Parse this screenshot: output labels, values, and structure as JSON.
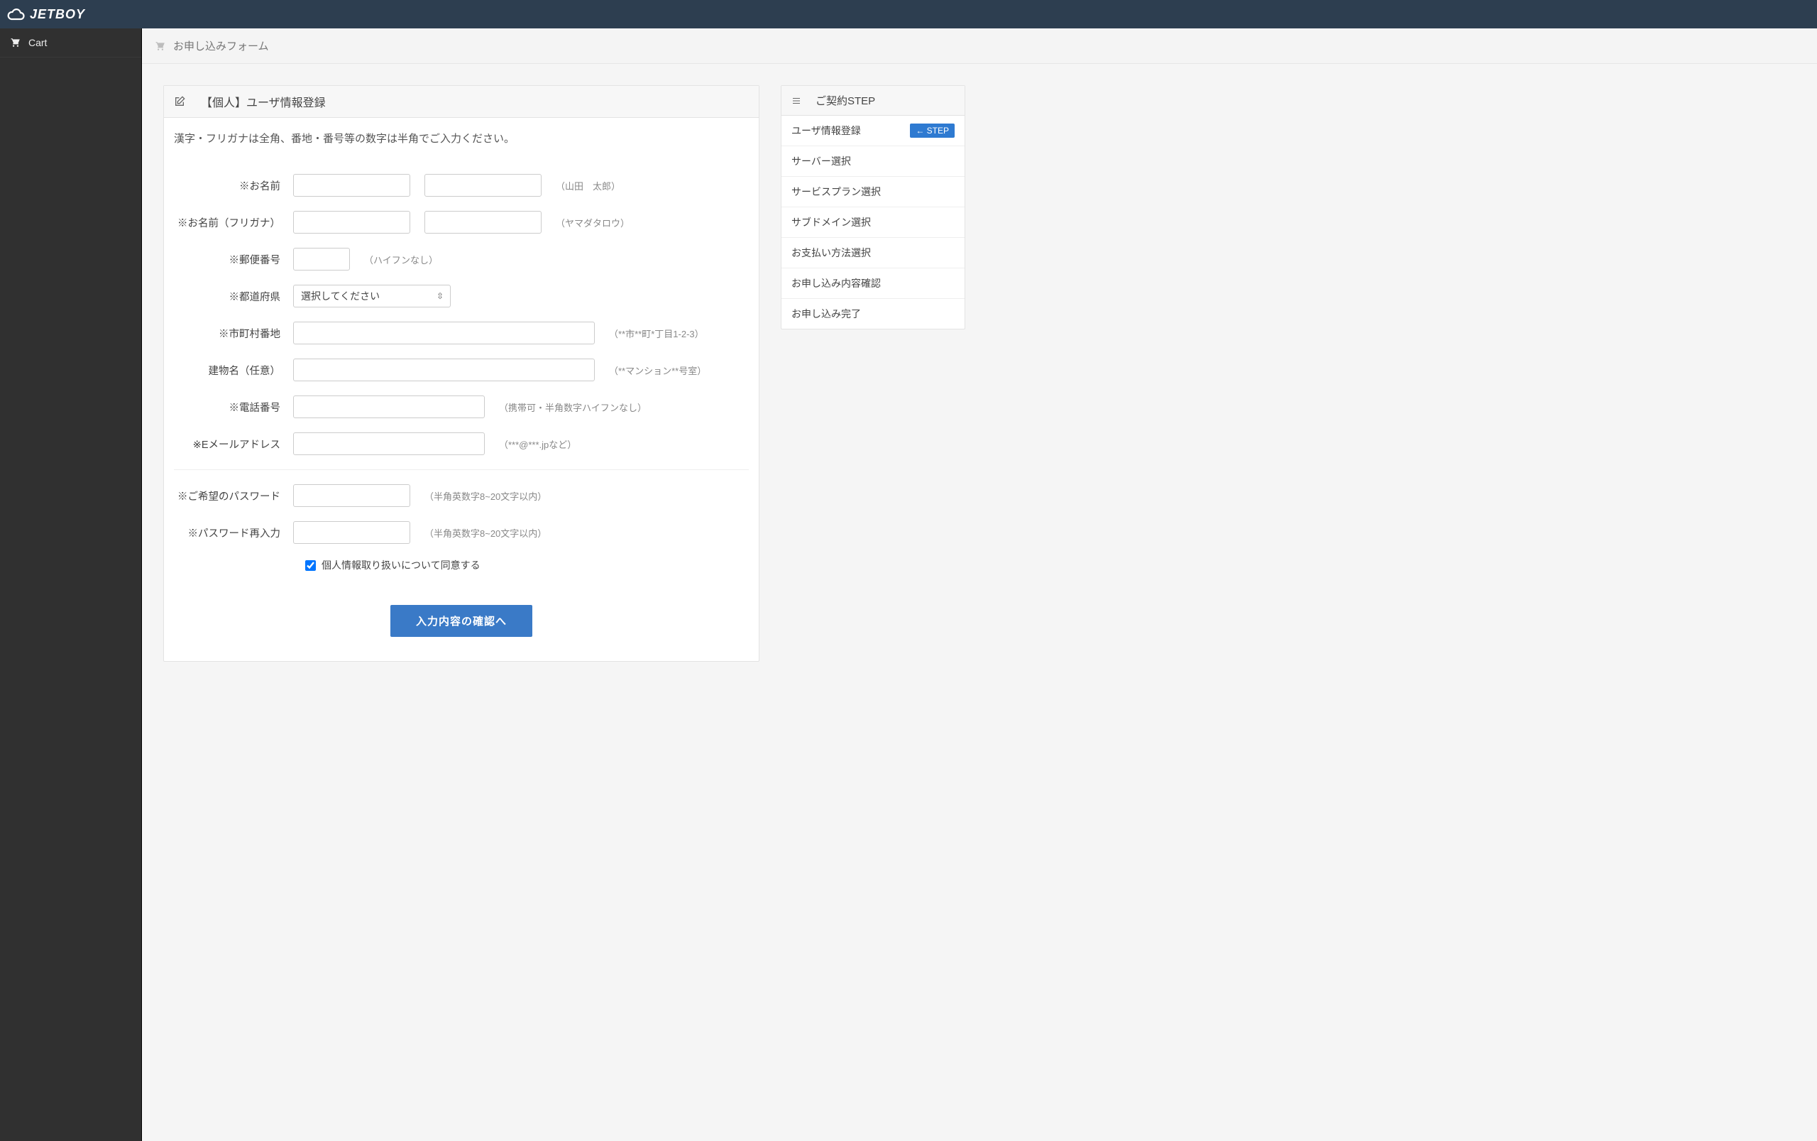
{
  "topbar": {
    "logo": "JETBOY"
  },
  "sidebar": {
    "items": [
      {
        "label": "Cart"
      }
    ]
  },
  "crumb": {
    "title": "お申し込みフォーム"
  },
  "form": {
    "header": "【個人】ユーザ情報登録",
    "instruction": "漢字・フリガナは全角、番地・番号等の数字は半角でご入力ください。",
    "rows": {
      "name": {
        "label": "※お名前",
        "hint": "（山田　太郎）"
      },
      "kana": {
        "label": "※お名前（フリガナ）",
        "hint": "（ヤマダタロウ）"
      },
      "zip": {
        "label": "※郵便番号",
        "hint": "（ハイフンなし）"
      },
      "pref": {
        "label": "※都道府県",
        "placeholder": "選択してください"
      },
      "city": {
        "label": "※市町村番地",
        "hint": "（**市**町*丁目1-2-3）"
      },
      "bldg": {
        "label": "建物名（任意）",
        "hint": "（**マンション**号室）"
      },
      "tel": {
        "label": "※電話番号",
        "hint": "（携帯可・半角数字ハイフンなし）"
      },
      "email": {
        "label": "※Eメールアドレス",
        "hint": "（***@***.jpなど）"
      },
      "pw": {
        "label": "※ご希望のパスワード",
        "hint": "（半角英数字8~20文字以内）"
      },
      "pw2": {
        "label": "※パスワード再入力",
        "hint": "（半角英数字8~20文字以内）"
      }
    },
    "consent": "個人情報取り扱いについて同意する",
    "submit": "入力内容の確認へ"
  },
  "steps": {
    "title": "ご契約STEP",
    "badge": "← STEP",
    "items": [
      {
        "label": "ユーザ情報登録",
        "current": true
      },
      {
        "label": "サーバー選択"
      },
      {
        "label": "サービスプラン選択"
      },
      {
        "label": "サブドメイン選択"
      },
      {
        "label": "お支払い方法選択"
      },
      {
        "label": "お申し込み内容確認"
      },
      {
        "label": "お申し込み完了"
      }
    ]
  }
}
